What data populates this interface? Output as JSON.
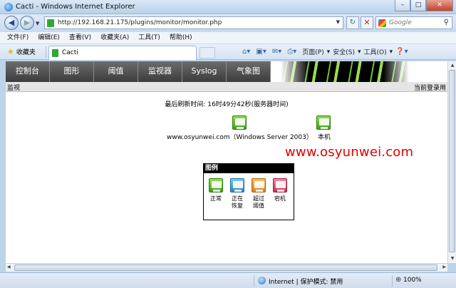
{
  "window": {
    "title": "Cacti - Windows Internet Explorer",
    "minimize": "–",
    "maximize": "□",
    "close": "✕"
  },
  "address": {
    "url": "http://192.168.21.175/plugins/monitor/monitor.php",
    "search_placeholder": "Google"
  },
  "menu": [
    "文件(F)",
    "编辑(E)",
    "查看(V)",
    "收藏夹(A)",
    "工具(T)",
    "帮助(H)"
  ],
  "commandbar": {
    "favorites": "收藏夹",
    "tab_title": "Cacti",
    "page": "页面(P)",
    "safety": "安全(S)",
    "tools": "工具(O)"
  },
  "nav": [
    "控制台",
    "图形",
    "阈值",
    "监视器",
    "Syslog",
    "气象图"
  ],
  "breadcrumb": {
    "left": "监视",
    "right": "当前登录用"
  },
  "content": {
    "refresh": "最后刷新时间: 16时49分42秒(服务器时间)",
    "host1": "www.osyunwei.com（Windows Server 2003）",
    "host2": "本机",
    "watermark": "www.osyunwei.com"
  },
  "legend": {
    "title": "图例",
    "items": [
      {
        "label": "正常",
        "color": "#4caf1f"
      },
      {
        "label": "正在\n恢复",
        "color": "#2b86c4"
      },
      {
        "label": "超过\n阈值",
        "color": "#d9831a"
      },
      {
        "label": "宕机",
        "color": "#cf2f55"
      }
    ]
  },
  "status": {
    "zone": "Internet | 保护模式: 禁用",
    "zoom": "100%"
  }
}
